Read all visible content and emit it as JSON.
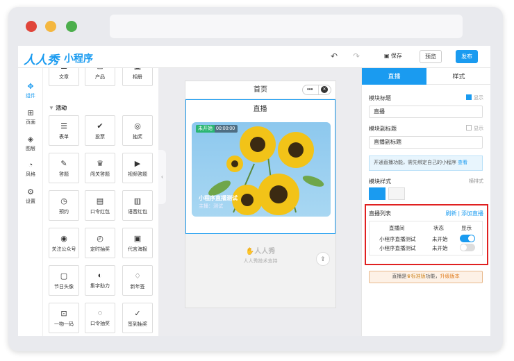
{
  "colors": {
    "accent": "#1a9bf0",
    "red": "#e0453a",
    "yellow": "#f4b73f",
    "green": "#4cae4c",
    "alert": "#e02020"
  },
  "header": {
    "logo": "人人秀",
    "product": "小程序",
    "save": "保存",
    "preview": "预览",
    "publish": "发布"
  },
  "leftnav": [
    {
      "label": "组件",
      "icon": "puzzle-icon"
    },
    {
      "label": "页面",
      "icon": "page-icon"
    },
    {
      "label": "图层",
      "icon": "layers-icon"
    },
    {
      "label": "风格",
      "icon": "palette-icon"
    },
    {
      "label": "设置",
      "icon": "gear-icon"
    }
  ],
  "palette": {
    "top_items": [
      "文章",
      "产品",
      "相册"
    ],
    "category": "活动",
    "items": [
      "表单",
      "投票",
      "抽奖",
      "答题",
      "闯关答题",
      "视频答题",
      "预约",
      "口令红包",
      "语音红包",
      "关注公众号",
      "定时抽奖",
      "代言海报",
      "节日头像",
      "集字助力",
      "新年签",
      "一物一码",
      "口令抽奖",
      "签到抽奖"
    ]
  },
  "phone": {
    "title": "首页",
    "section_title": "直播",
    "badge_status": "未开始",
    "badge_time": "00:00:00",
    "card_title": "小程序直播测试",
    "card_host": "主播：测试",
    "watermark": "人人秀",
    "support": "人人秀技术支持"
  },
  "panel": {
    "tabs": [
      "直播",
      "样式"
    ],
    "module_title_label": "模块标题",
    "module_title_value": "直播",
    "show1": "显示",
    "module_subtitle_label": "模块副标题",
    "module_subtitle_value": "直播副标题",
    "show2": "显示",
    "tip": "开通直播功能，需先绑定自己的小程序",
    "tip_link": "查看",
    "style_label": "模块样式",
    "style_hint": "横排式",
    "list_label": "直播列表",
    "refresh": "刷新",
    "add": "添加直播",
    "columns": [
      "直播间",
      "状态",
      "显示"
    ],
    "rows": [
      {
        "name": "小程序直播测试",
        "status": "未开始",
        "shown": true
      },
      {
        "name": "小程序直播测试",
        "status": "未开始",
        "shown": false
      }
    ],
    "notice_pre": "直播是",
    "notice_badge": "标准版",
    "notice_mid": "功能，",
    "notice_link": "升级版本"
  }
}
